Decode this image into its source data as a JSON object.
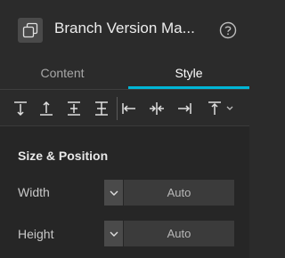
{
  "header": {
    "title": "Branch Version Ma...",
    "icon": "copy-icon",
    "help_icon": "help-icon"
  },
  "tabs": [
    {
      "label": "Content",
      "active": false
    },
    {
      "label": "Style",
      "active": true
    }
  ],
  "toolbar": {
    "buttons": [
      "align-top-icon",
      "align-bottom-icon",
      "align-vertical-center-icon",
      "distribute-vertical-icon",
      "align-left-icon",
      "align-horizontal-center-icon",
      "align-right-icon",
      "align-top-dropdown-icon"
    ]
  },
  "section": {
    "title": "Size & Position",
    "rows": [
      {
        "label": "Width",
        "value": "Auto"
      },
      {
        "label": "Height",
        "value": "Auto"
      }
    ]
  },
  "colors": {
    "accent": "#00b6d6",
    "panel": "#2b2b2b",
    "body": "#262626"
  }
}
